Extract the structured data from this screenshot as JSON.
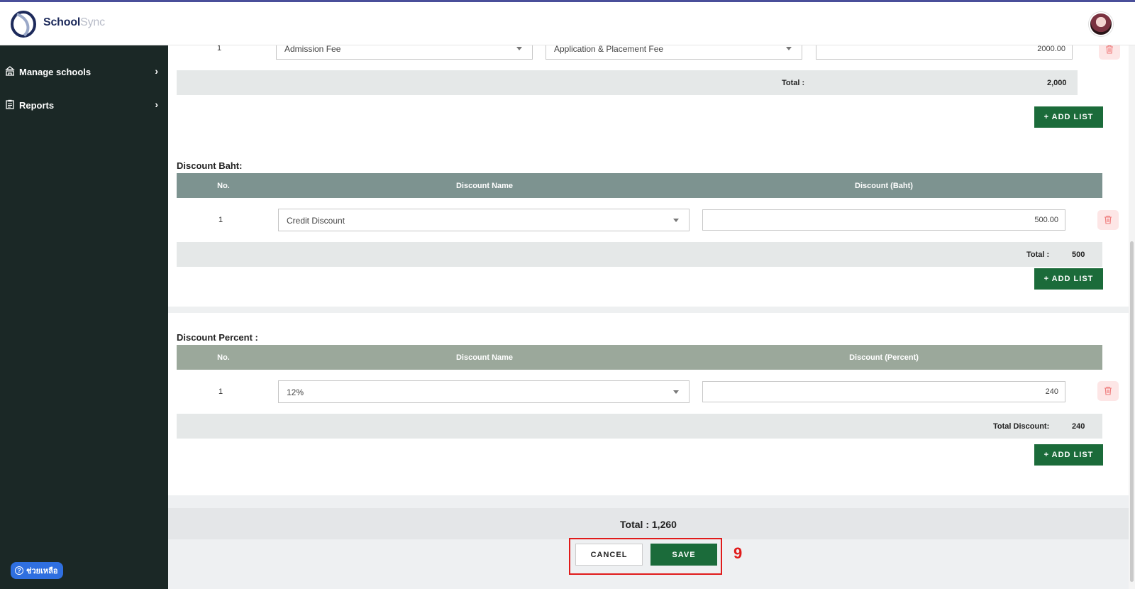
{
  "brand": {
    "name_bold": "School",
    "name_light": "Sync"
  },
  "sidebar": {
    "items": [
      {
        "label": "Manage schools",
        "icon": "school-icon"
      },
      {
        "label": "Reports",
        "icon": "clipboard-icon"
      }
    ],
    "help_label": "ช่วยเหลือ"
  },
  "fees": {
    "row": {
      "no": "1",
      "category": "Admission Fee",
      "item": "Application & Placement Fee",
      "amount": "2000.00"
    },
    "total_label": "Total :",
    "total_value": "2,000",
    "add_label": "+ ADD LIST"
  },
  "discount_baht": {
    "title": "Discount Baht:",
    "headers": [
      "No.",
      "Discount Name",
      "Discount (Baht)"
    ],
    "row": {
      "no": "1",
      "name": "Credit Discount",
      "amount": "500.00"
    },
    "total_label": "Total :",
    "total_value": "500",
    "add_label": "+ ADD LIST"
  },
  "discount_percent": {
    "title": "Discount Percent :",
    "headers": [
      "No.",
      "Discount Name",
      "Discount (Percent)"
    ],
    "row": {
      "no": "1",
      "name": "12%",
      "amount": "240"
    },
    "total_label": "Total Discount:",
    "total_value": "240",
    "add_label": "+ ADD LIST"
  },
  "summary": {
    "grand_total": "Total : 1,260"
  },
  "actions": {
    "cancel": "CANCEL",
    "save": "SAVE",
    "step_marker": "9"
  },
  "colors": {
    "sidebar_bg": "#1b2826",
    "primary_green": "#1b6b3a",
    "header_baht": "#7d9390",
    "header_percent": "#9ba89b",
    "annotation_red": "#e01b1b",
    "trash_bg": "#fde6e6"
  }
}
